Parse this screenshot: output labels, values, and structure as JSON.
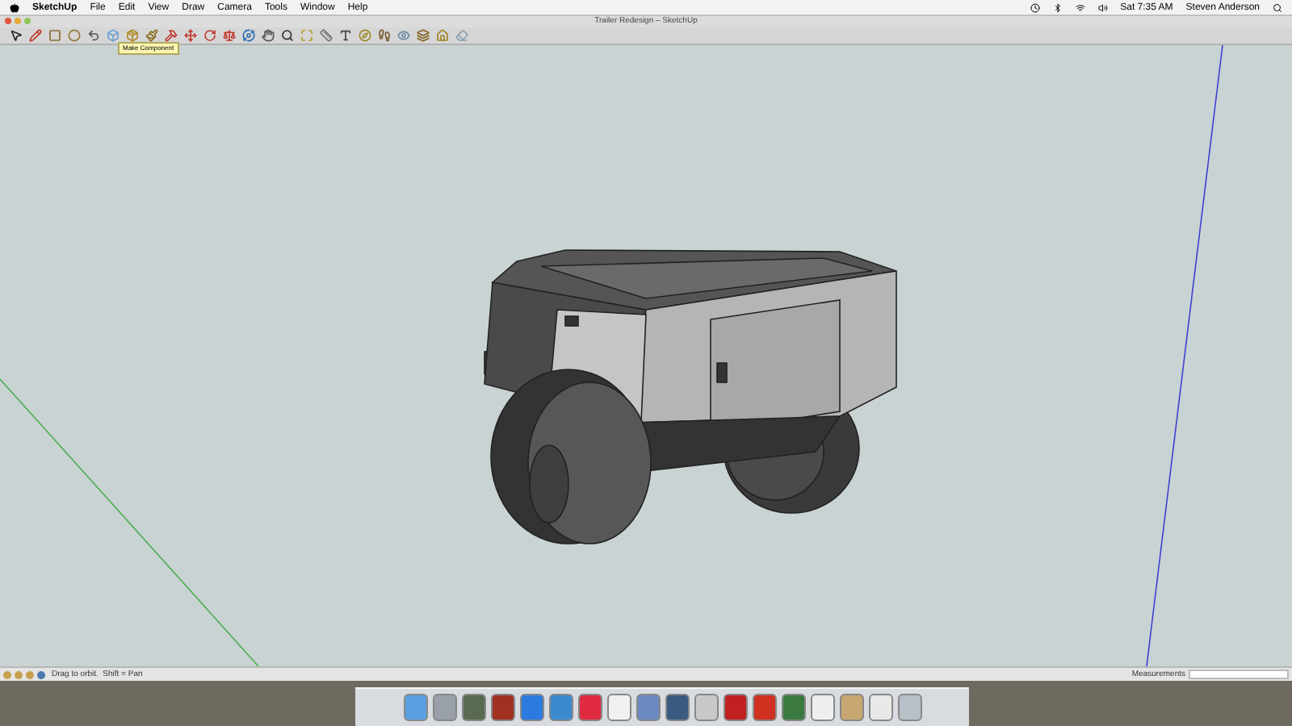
{
  "menu_bar": {
    "app_name": "SketchUp",
    "menus": [
      "File",
      "Edit",
      "View",
      "Draw",
      "Camera",
      "Tools",
      "Window",
      "Help"
    ],
    "clock": "Sat 7:35 AM",
    "user": "Steven Anderson"
  },
  "window": {
    "title": "Trailer Redesign – SketchUp"
  },
  "tooltip": {
    "text": "Make Component"
  },
  "status_bar": {
    "hint": "Drag to orbit.  Shift = Pan",
    "measurements_label": "Measurements"
  }
}
